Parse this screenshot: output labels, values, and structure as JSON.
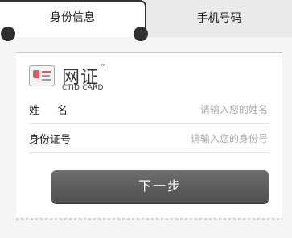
{
  "tabs": [
    {
      "label": "身份信息",
      "active": true
    },
    {
      "label": "手机号码",
      "active": false
    }
  ],
  "card": {
    "brand": {
      "title": "网证",
      "trademark": "™",
      "subtitle": "CTID CARD"
    },
    "fields": [
      {
        "label": "姓名",
        "placeholder": "请输入您的姓名",
        "value": ""
      },
      {
        "label": "身份证号",
        "placeholder": "请输入您的身份号",
        "value": ""
      }
    ],
    "next_label": "下一步"
  }
}
